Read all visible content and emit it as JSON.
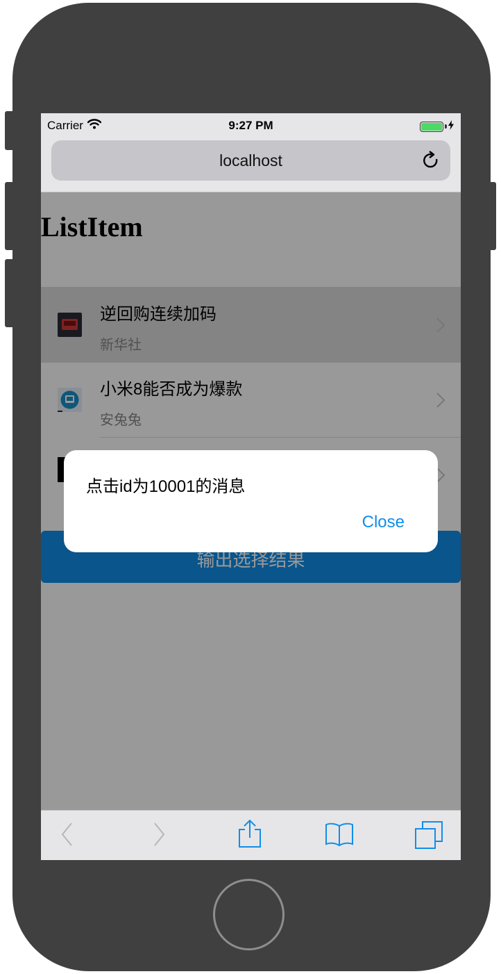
{
  "status_bar": {
    "carrier": "Carrier",
    "time": "9:27 PM"
  },
  "browser": {
    "url": "localhost"
  },
  "page": {
    "title": "ListItem",
    "items": [
      {
        "title": "逆回购连续加码",
        "brief": "新华社"
      },
      {
        "title": "小米8能否成为爆款",
        "brief": "安兔兔"
      }
    ],
    "submit_label": "输出选择结果"
  },
  "modal": {
    "message": "点击id为10001的消息",
    "close_label": "Close"
  },
  "colors": {
    "primary": "#108ee9",
    "battery": "#4cd964",
    "device": "#404040"
  },
  "icons": [
    "wifi-icon",
    "battery-icon",
    "charging-icon",
    "reload-icon",
    "chevron-right-icon",
    "back-icon",
    "forward-icon",
    "share-icon",
    "bookmarks-icon",
    "tabs-icon"
  ]
}
